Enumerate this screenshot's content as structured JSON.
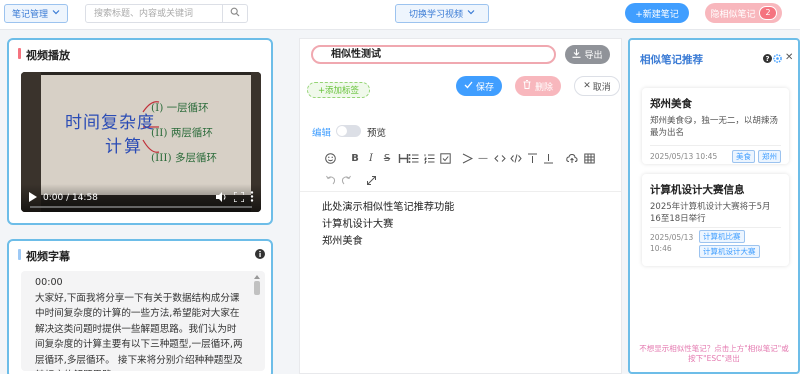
{
  "topbar": {
    "notes_menu_label": "笔记管理",
    "search_placeholder": "搜索标题、内容或关键词",
    "switch_video_label": "切换学习视频",
    "new_note_label": "+新建笔记",
    "similar_notes_label": "隐相似笔记",
    "similar_count": "2"
  },
  "video_panel": {
    "title": "视频播放",
    "whiteboard": {
      "title": "时间复杂度",
      "subtitle": "计算",
      "items": [
        "(I) 一层循环",
        "(II) 两层循环",
        "(III) 多层循环"
      ]
    },
    "time": "0:00 / 14:58"
  },
  "subtitle_panel": {
    "title": "视频字幕",
    "timestamp": "00:00",
    "text": "大家好,下面我将分享一下有关于数据结构成分课中时间复杂度的计算的一些方法,希望能对大家在解决这类问题时提供一些解题思路。我们认为时间复杂度的计算主要有以下三种题型,一层循环,两层循环,多层循环。 接下来将分别介绍种种题型及其相应的解题思路。"
  },
  "editor": {
    "title": "相似性测试",
    "export_label": "导出",
    "add_tag_label": "+添加标签",
    "save_label": "保存",
    "delete_label": "删除",
    "cancel_label": "取消",
    "mode_edit": "编辑",
    "mode_preview": "预览",
    "content_lines": [
      "此处演示相似性笔记推荐功能",
      "计算机设计大赛",
      "郑州美食"
    ]
  },
  "sidebar": {
    "title": "相似笔记推荐",
    "recommendations": [
      {
        "title": "郑州美食",
        "description": "郑州美食😋，独一无二，以胡辣汤最为出名",
        "date": "2025/05/13 10:45",
        "tags": [
          "美食",
          "郑州"
        ]
      },
      {
        "title": "计算机设计大赛信息",
        "description": "2025年计算机设计大赛将于5月16至18日举行",
        "date_line1": "2025/05/13",
        "date_line2": "10:46",
        "tags": [
          "计算机比赛",
          "计算机设计大赛"
        ]
      }
    ],
    "hint": "不想显示相似性笔记？点击上方\"相似笔记\"或按下\"ESC\"退出"
  },
  "colors": {
    "accent": "#409eff",
    "panel_border": "#6dbde8",
    "pink": "#f8b7bd"
  }
}
